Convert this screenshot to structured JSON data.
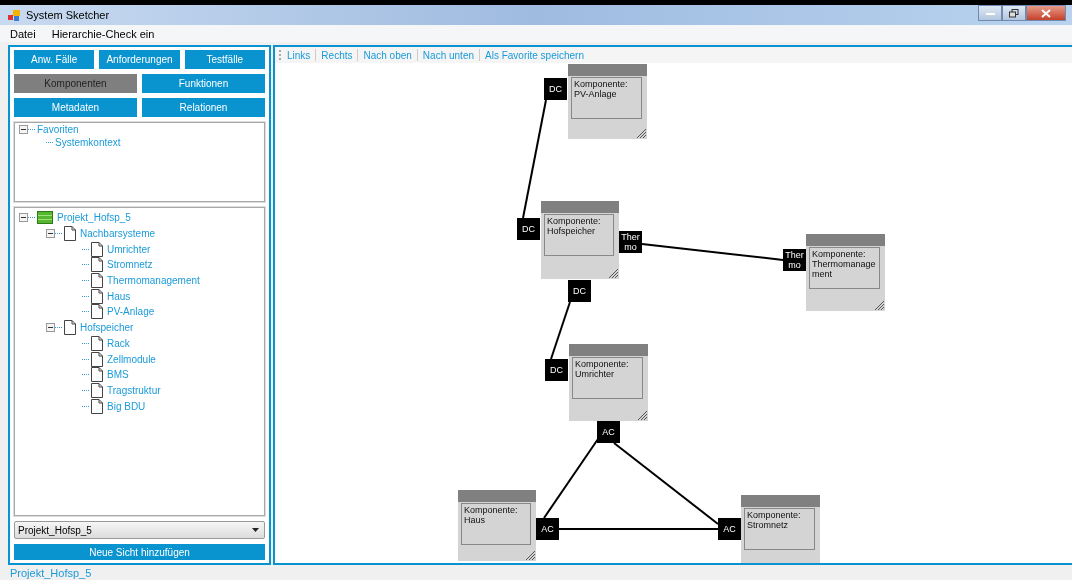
{
  "window": {
    "title": "System Sketcher"
  },
  "menu": [
    "Datei",
    "Hierarchie-Check ein"
  ],
  "nav_buttons": [
    {
      "label": "Anw. Fälle",
      "selected": false
    },
    {
      "label": "Anforderungen",
      "selected": false
    },
    {
      "label": "Testfälle",
      "selected": false
    },
    {
      "label": "Komponenten",
      "selected": true
    },
    {
      "label": "Funktionen",
      "selected": false
    },
    {
      "label": "Metadaten",
      "selected": false
    },
    {
      "label": "Relationen",
      "selected": false
    }
  ],
  "favorites_tree": [
    {
      "label": "Favoriten",
      "expanded": true,
      "children": [
        {
          "label": "Systemkontext"
        }
      ]
    }
  ],
  "project_tree": [
    {
      "label": "Projekt_Hofsp_5",
      "kind": "project",
      "expanded": true,
      "children": [
        {
          "label": "Nachbarsysteme",
          "kind": "document",
          "expanded": true,
          "children": [
            {
              "label": "Umrichter",
              "kind": "document"
            },
            {
              "label": "Stromnetz",
              "kind": "document"
            },
            {
              "label": "Thermomanagement",
              "kind": "document"
            },
            {
              "label": "Haus",
              "kind": "document"
            },
            {
              "label": "PV-Anlage",
              "kind": "document"
            }
          ]
        },
        {
          "label": "Hofspeicher",
          "kind": "document",
          "expanded": true,
          "children": [
            {
              "label": "Rack",
              "kind": "document"
            },
            {
              "label": "Zellmodule",
              "kind": "document"
            },
            {
              "label": "BMS",
              "kind": "document"
            },
            {
              "label": "Tragstruktur",
              "kind": "document"
            },
            {
              "label": "Big BDU",
              "kind": "document"
            }
          ]
        }
      ]
    }
  ],
  "view_select": {
    "value": "Projekt_Hofsp_5"
  },
  "add_view_button": "Neue Sicht hinzufügen",
  "toolbar": [
    "Links",
    "Rechts",
    "Nach oben",
    "Nach unten",
    "Als Favorite speichern"
  ],
  "components": [
    {
      "lines": [
        "Komponente:",
        "PV-Anlage"
      ]
    },
    {
      "lines": [
        "Komponente:",
        "Hofspeicher"
      ]
    },
    {
      "lines": [
        "Komponente:",
        "Thermomanage",
        "ment"
      ]
    },
    {
      "lines": [
        "Komponente:",
        "Umrichter"
      ]
    },
    {
      "lines": [
        "Komponente:",
        "Haus"
      ]
    },
    {
      "lines": [
        "Komponente:",
        "Stromnetz"
      ]
    }
  ],
  "ports": [
    {
      "lines": [
        "DC"
      ]
    },
    {
      "lines": [
        "DC"
      ]
    },
    {
      "lines": [
        "Ther",
        "mo"
      ]
    },
    {
      "lines": [
        "DC"
      ]
    },
    {
      "lines": [
        "Ther",
        "mo"
      ]
    },
    {
      "lines": [
        "DC"
      ]
    },
    {
      "lines": [
        "AC"
      ]
    },
    {
      "lines": [
        "AC"
      ]
    },
    {
      "lines": [
        "AC"
      ]
    }
  ],
  "status_bar": "Projekt_Hofsp_5"
}
